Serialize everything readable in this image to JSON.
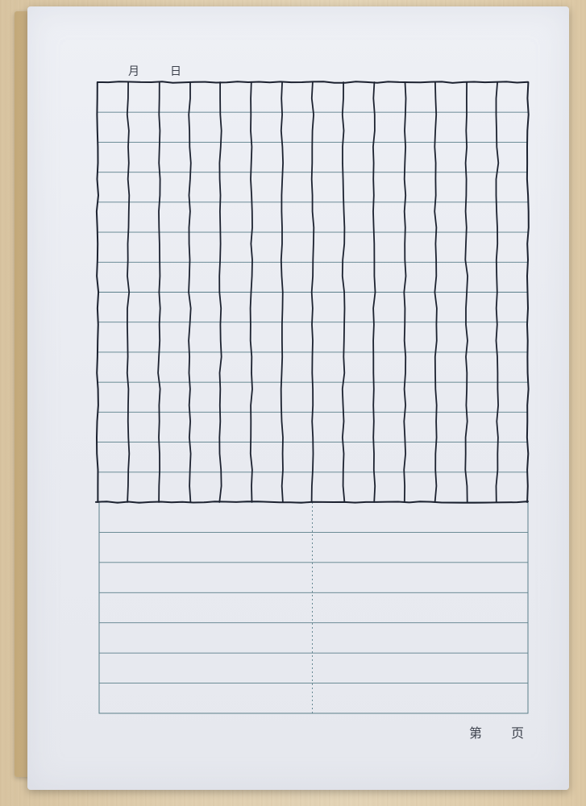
{
  "header": {
    "month_label": "月",
    "day_label": "日"
  },
  "footer": {
    "page_prefix": "第",
    "page_suffix": "页"
  },
  "worksheet": {
    "grid_columns": 14,
    "grid_rows": 14,
    "writing_lines": 7,
    "ink_color": "#1c2230",
    "printed_line_color": "#5b7f8a",
    "paper_color": "#eceef3"
  }
}
